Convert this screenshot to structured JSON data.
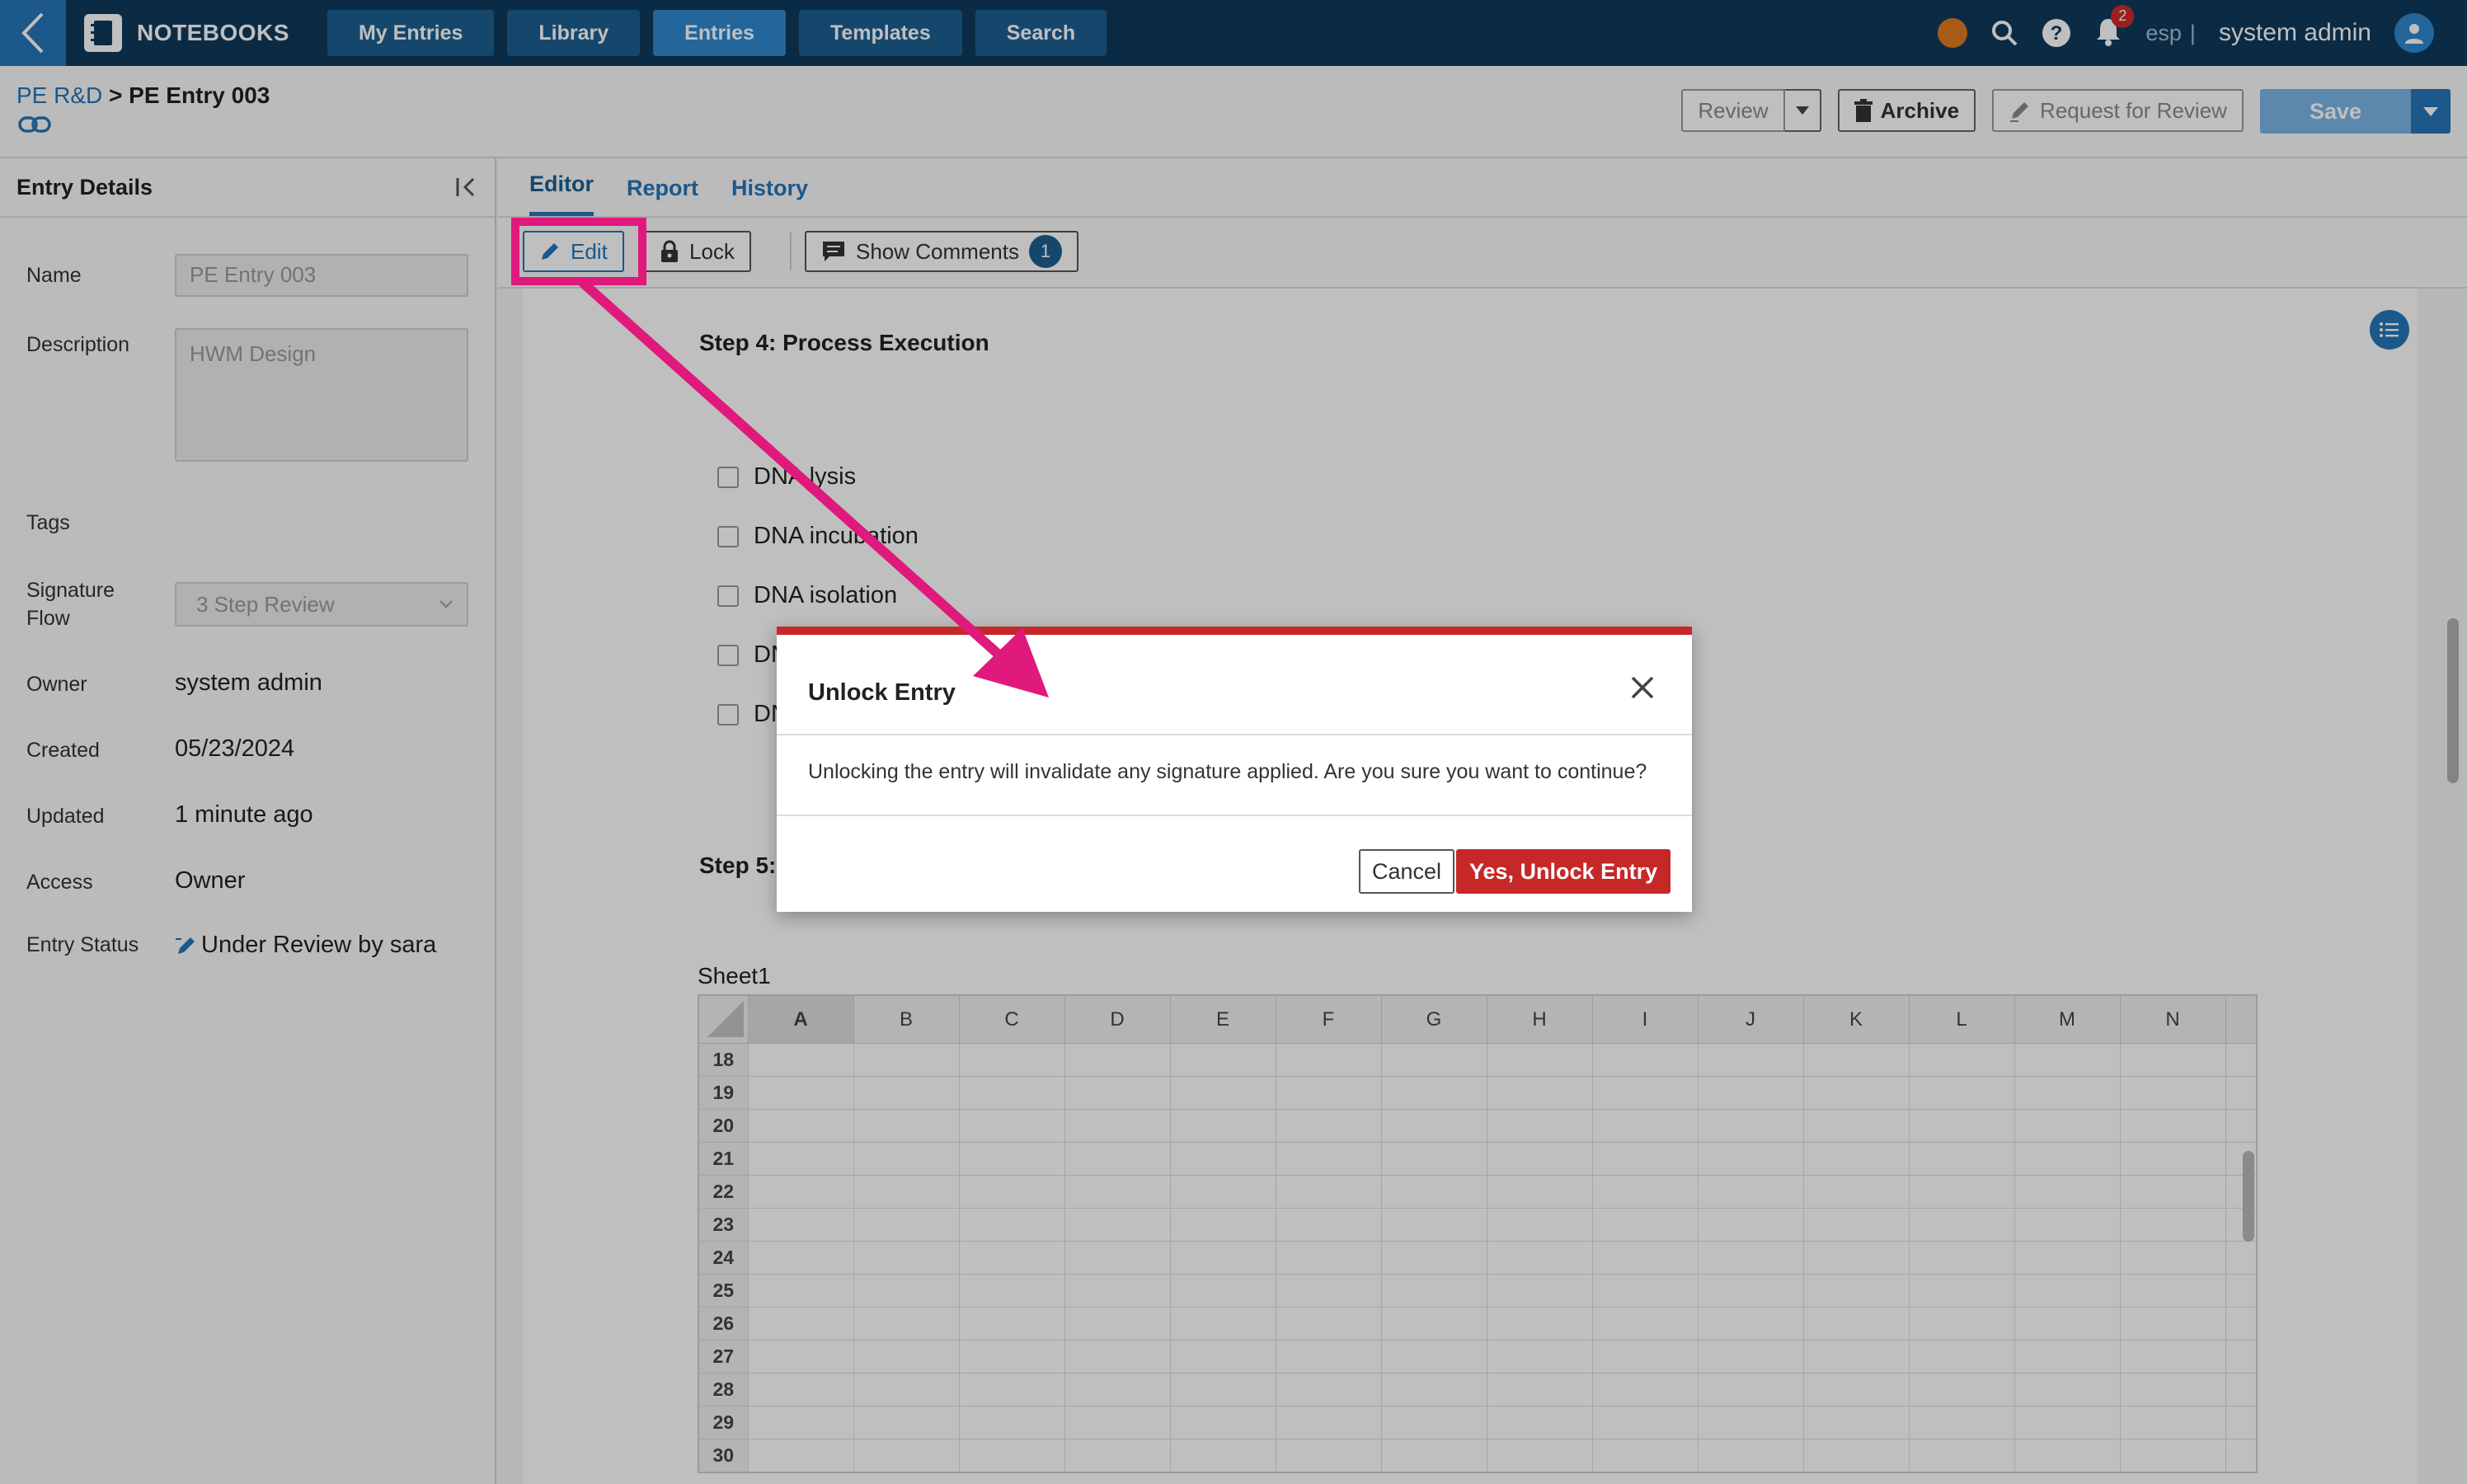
{
  "topbar": {
    "brand": "NOTEBOOKS",
    "nav": [
      "My Entries",
      "Library",
      "Entries",
      "Templates",
      "Search"
    ],
    "active_nav": "Entries",
    "notifications": "2",
    "lang": "esp",
    "separator": "|",
    "user": "system admin"
  },
  "breadcrumb": {
    "parent": "PE R&D",
    "sep": " > ",
    "current": "PE Entry 003"
  },
  "actions": {
    "review": "Review",
    "archive": "Archive",
    "request_review": "Request for Review",
    "save": "Save"
  },
  "left_panel": {
    "title": "Entry Details",
    "labels": {
      "name": "Name",
      "description": "Description",
      "tags": "Tags",
      "signature_flow_1": "Signature",
      "signature_flow_2": "Flow",
      "owner": "Owner",
      "created": "Created",
      "updated": "Updated",
      "access": "Access",
      "entry_status": "Entry Status"
    },
    "values": {
      "name": "PE Entry 003",
      "description": "HWM Design",
      "signature_flow": "3 Step Review",
      "owner": "system admin",
      "created": "05/23/2024",
      "updated": "1 minute ago",
      "access": "Owner",
      "entry_status": "Under Review by sara"
    }
  },
  "tabs": [
    "Editor",
    "Report",
    "History"
  ],
  "toolbar": {
    "edit": "Edit",
    "lock": "Lock",
    "show_comments": "Show Comments",
    "comment_count": "1"
  },
  "editor": {
    "step4": "Step 4: Process Execution",
    "checklist": [
      "DNA lysis",
      "DNA incubation",
      "DNA isolation",
      "DN",
      "DN"
    ],
    "step5": "Step 5:",
    "sheet_name": "Sheet1",
    "columns": [
      "A",
      "B",
      "C",
      "D",
      "E",
      "F",
      "G",
      "H",
      "I",
      "J",
      "K",
      "L",
      "M",
      "N"
    ],
    "rows": [
      "18",
      "19",
      "20",
      "21",
      "22",
      "23",
      "24",
      "25",
      "26",
      "27",
      "28",
      "29",
      "30"
    ]
  },
  "modal": {
    "title": "Unlock Entry",
    "body": "Unlocking the entry will invalidate any signature applied. Are you sure you want to continue?",
    "cancel": "Cancel",
    "confirm": "Yes, Unlock Entry"
  },
  "colors": {
    "nav_bg": "#0f3a5c",
    "accent": "#2676b8",
    "danger": "#c62828",
    "annotation": "#e0197d",
    "status_dot": "#e07a1f"
  }
}
